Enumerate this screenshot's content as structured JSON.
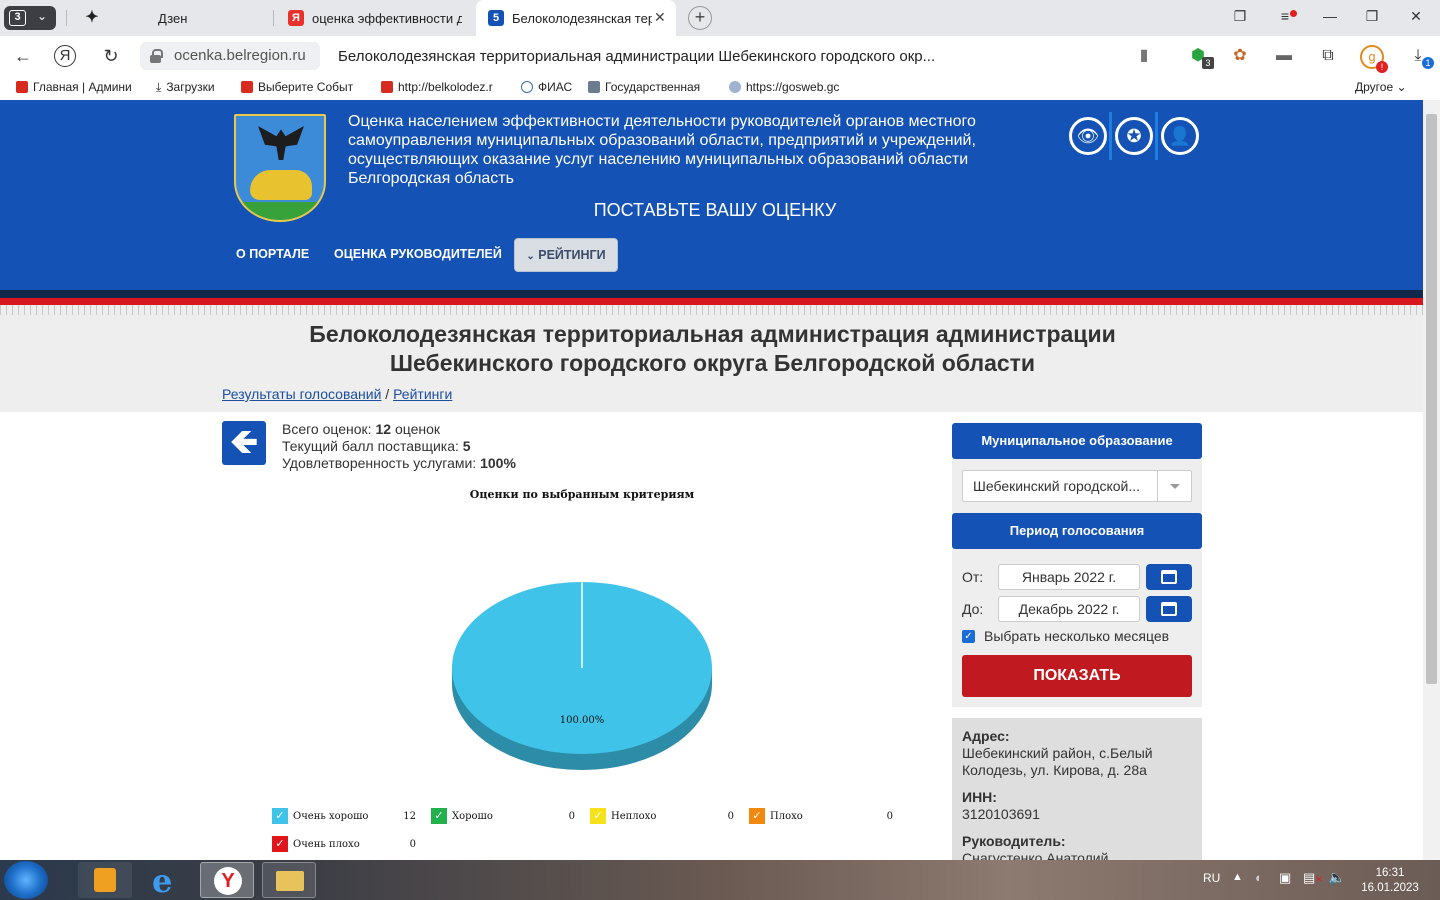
{
  "browser": {
    "tab_count": "3",
    "tabs": [
      {
        "title": "Дзен",
        "icon": "sparkle-icon"
      },
      {
        "title": "оценка эффективности де",
        "icon": "yandex-icon"
      },
      {
        "title": "Белоколодезянская тер",
        "icon": "site-5-icon",
        "active": true
      }
    ],
    "url": "ocenka.belregion.ru",
    "page_title": "Белоколодезянская территориальная администрации Шебекинского городского окр...",
    "badge_count": "3",
    "download_badge": "1",
    "bookmarks": [
      "Главная | Админи",
      "Загрузки",
      "Выберите Событ",
      "http://belkolodez.r",
      "ФИАС",
      "Государственная",
      "https://gosweb.gc"
    ],
    "bookmarks_other": "Другое"
  },
  "header": {
    "description": "Оценка населением эффективности деятельности руководителей органов местного самоуправления муниципальных образований области, предприятий и учреждений, осуществляющих оказание услуг населению муниципальных образований области Белгородская область",
    "cta": "ПОСТАВЬТЕ ВАШУ ОЦЕНКУ",
    "menu": {
      "about": "О ПОРТАЛЕ",
      "leaders": "ОЦЕНКА РУКОВОДИТЕЛЕЙ",
      "ratings": "РЕЙТИНГИ"
    }
  },
  "page": {
    "title_line1": "Белоколодезянская территориальная администрация администрации",
    "title_line2": "Шебекинского городского округа Белгородской области",
    "breadcrumb": {
      "results": "Результаты голосований",
      "sep": "/",
      "ratings": "Рейтинги"
    }
  },
  "stats": {
    "total_label": "Всего оценок:",
    "total_value": "12",
    "total_unit": "оценок",
    "score_label": "Текущий балл поставщика:",
    "score_value": "5",
    "satisfaction_label": "Удовлетворенность услугами:",
    "satisfaction_value": "100%"
  },
  "chart_data": {
    "type": "pie",
    "title": "Оценки по выбранным критериям",
    "slices": [
      {
        "name": "Очень хорошо",
        "value": 12,
        "color": "#3fc3e8"
      },
      {
        "name": "Хорошо",
        "value": 0,
        "color": "#22b14c"
      },
      {
        "name": "Неплохо",
        "value": 0,
        "color": "#f5e21a"
      },
      {
        "name": "Плохо",
        "value": 0,
        "color": "#f2890f"
      },
      {
        "name": "Очень плохо",
        "value": 0,
        "color": "#e0141c"
      }
    ],
    "data_label": "100.00%"
  },
  "filters": {
    "municipality_header": "Муниципальное образование",
    "municipality_value": "Шебекинский городской...",
    "period_header": "Период голосования",
    "from_label": "От:",
    "from_value": "Январь 2022 г.",
    "to_label": "До:",
    "to_value": "Декабрь 2022 г.",
    "multi_month_label": "Выбрать несколько месяцев",
    "multi_month_checked": true,
    "show_button": "ПОКАЗАТЬ"
  },
  "info": {
    "address_label": "Адрес:",
    "address_value": "Шебекинский район, с.Белый Колодезь, ул. Кирова, д. 28а",
    "inn_label": "ИНН:",
    "inn_value": "3120103691",
    "head_label": "Руководитель:",
    "head_value": "Снагустенко Анатолий"
  },
  "taskbar": {
    "lang": "RU",
    "time": "16:31",
    "date": "16.01.2023"
  }
}
